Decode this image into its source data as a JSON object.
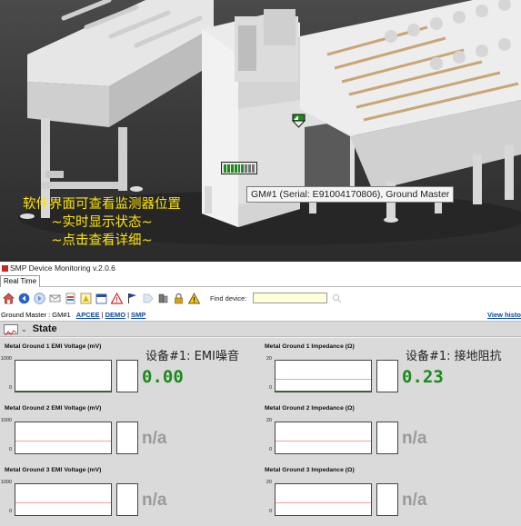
{
  "scene": {
    "caption": [
      "软件界面可查看监测器位置",
      "~实时显示状态~",
      "~点击查看详细~"
    ],
    "tooltip": "GM#1 (Serial: E91004170806), Ground Master"
  },
  "app": {
    "title": "SMP Device Monitoring v.2.0.6",
    "tab": "Real Time",
    "toolbar": {
      "icons": [
        "home-icon",
        "back-icon",
        "refresh-icon",
        "mail-icon",
        "report-icon",
        "warning-report-icon",
        "calendar-icon",
        "alarm-icon",
        "flag-icon",
        "tag-icon",
        "devices-icon",
        "lock-icon",
        "warning-icon"
      ],
      "find_label": "Find device:",
      "find_value": ""
    },
    "crumbs": {
      "prefix": "Ground Master : GM#1",
      "links": [
        "APCEE",
        "DEMO",
        "SMP"
      ],
      "view_history": "View histo"
    },
    "state_label": "State",
    "metrics": [
      {
        "title": "Metal Ground 1 EMI Voltage (mV)",
        "ymax": "1000",
        "ymin": "0",
        "value": "0.00",
        "annotation": "设备#1: EMI噪音"
      },
      {
        "title": "Metal Ground 1 Impedance (Ω)",
        "ymax": "20",
        "ymin": "0",
        "value": "0.23",
        "annotation": "设备#1: 接地阻抗"
      },
      {
        "title": "Metal Ground 2 EMI Voltage (mV)",
        "ymax": "1000",
        "ymin": "0",
        "value": "n/a",
        "annotation": ""
      },
      {
        "title": "Metal Ground 2 Impedance (Ω)",
        "ymax": "20",
        "ymin": "0",
        "value": "n/a",
        "annotation": ""
      },
      {
        "title": "Metal Ground 3 EMI Voltage (mV)",
        "ymax": "1000",
        "ymin": "0",
        "value": "n/a",
        "annotation": ""
      },
      {
        "title": "Metal Ground 3 Impedance (Ω)",
        "ymax": "20",
        "ymin": "0",
        "value": "n/a",
        "annotation": ""
      }
    ],
    "colors": {
      "ok_value": "#1b8a1b",
      "na_value": "#9a9a9a",
      "threshold_line": "#f2a0a0",
      "find_bg": "#ffffd8",
      "caption": "#ffe600"
    }
  }
}
